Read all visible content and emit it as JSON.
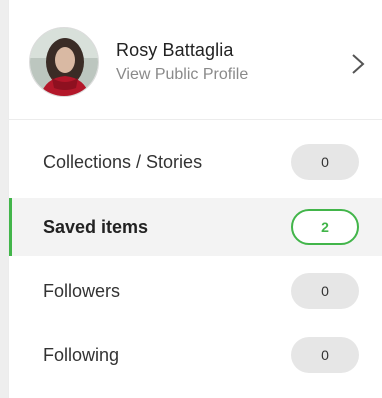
{
  "profile": {
    "name": "Rosy Battaglia",
    "link_label": "View Public Profile",
    "chevron_icon": "chevron-right-icon"
  },
  "menu": {
    "items": [
      {
        "label": "Collections / Stories",
        "count": "0",
        "active": false
      },
      {
        "label": "Saved items",
        "count": "2",
        "active": true
      },
      {
        "label": "Followers",
        "count": "0",
        "active": false
      },
      {
        "label": "Following",
        "count": "0",
        "active": false
      }
    ]
  },
  "colors": {
    "accent": "#42b54a",
    "badge_bg": "#e6e6e6",
    "active_bg": "#f3f3f3"
  }
}
